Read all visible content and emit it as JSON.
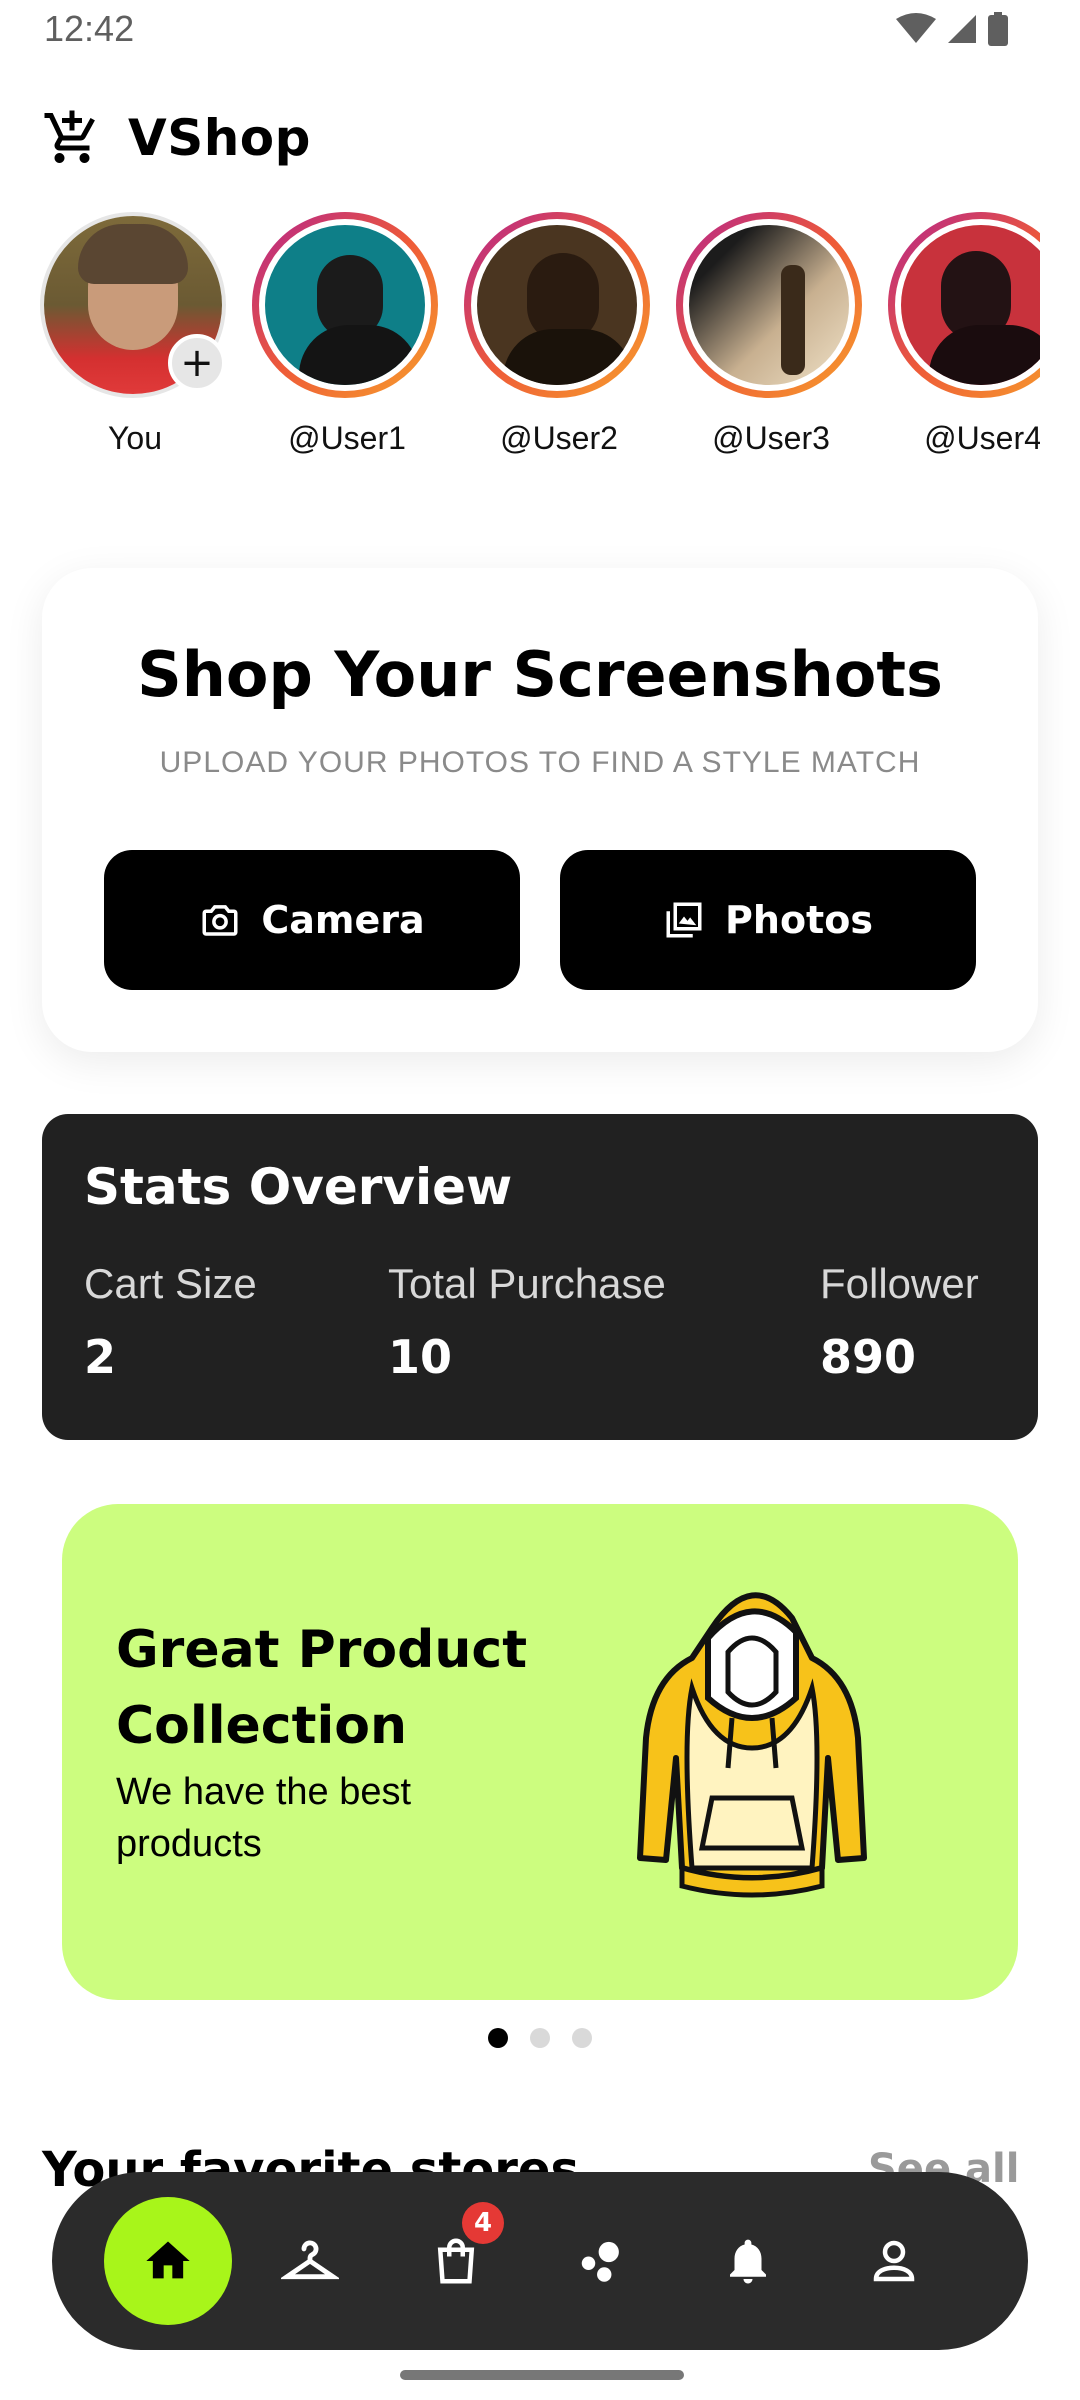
{
  "status_bar": {
    "time": "12:42"
  },
  "header": {
    "title": "VShop",
    "icon": "add-to-cart-icon"
  },
  "stories": [
    {
      "label": "You",
      "has_add": true
    },
    {
      "label": "@User1"
    },
    {
      "label": "@User2"
    },
    {
      "label": "@User3"
    },
    {
      "label": "@User4"
    }
  ],
  "shop": {
    "title": "Shop Your Screenshots",
    "subtitle": "UPLOAD YOUR PHOTOS TO FIND A STYLE MATCH",
    "camera_label": "Camera",
    "photos_label": "Photos"
  },
  "stats": {
    "title": "Stats Overview",
    "items": [
      {
        "label": "Cart Size",
        "value": "2"
      },
      {
        "label": "Total Purchase",
        "value": "10"
      },
      {
        "label": "Follower",
        "value": "890"
      }
    ]
  },
  "promo": {
    "title_line1": "Great Product",
    "title_line2": "Collection",
    "subtitle": "We have the best products",
    "accent": "#ccfd7f"
  },
  "carousel": {
    "active_index": 0,
    "count": 3
  },
  "favorites": {
    "title": "Your favorite stores",
    "see_all": "See all"
  },
  "bottom_nav": {
    "items": [
      "home-icon",
      "hanger-icon",
      "shopping-bag-icon",
      "bubbles-icon",
      "bell-icon",
      "profile-icon"
    ],
    "badge": "4",
    "accent": "#a8f51a"
  }
}
